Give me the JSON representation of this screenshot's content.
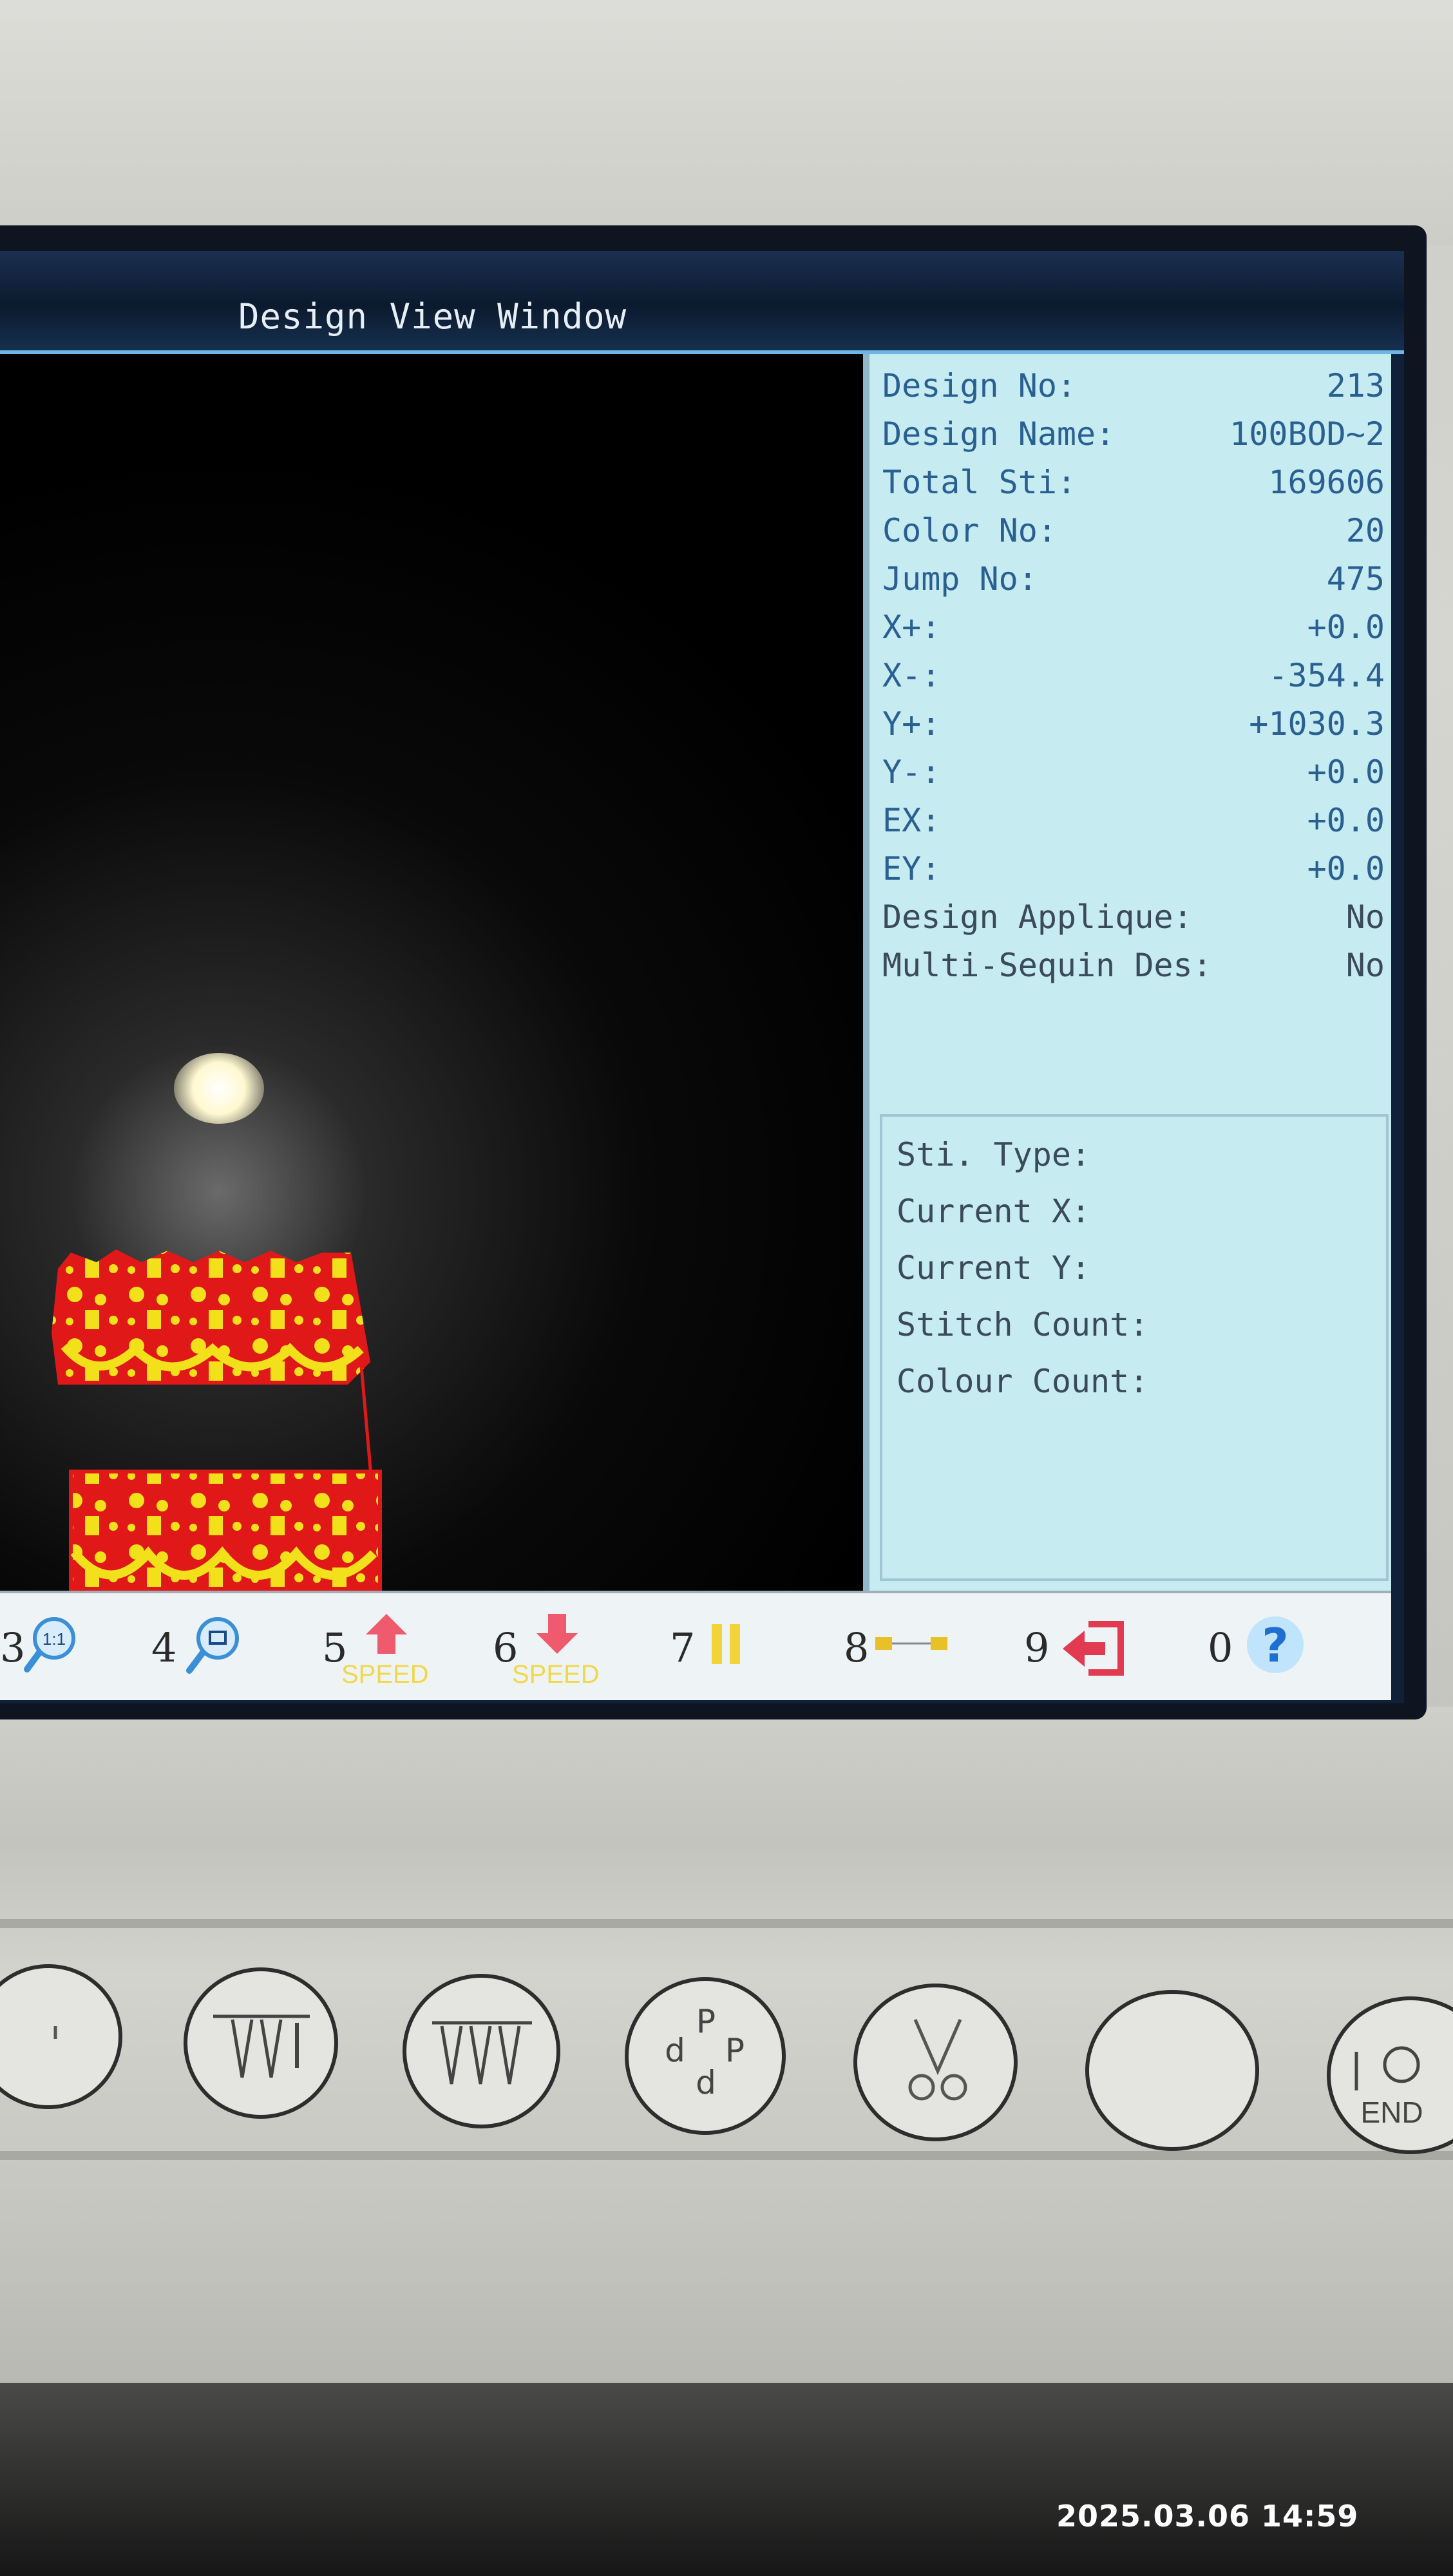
{
  "window": {
    "title": "Design View Window"
  },
  "info": {
    "rows": [
      {
        "label": "Design No:",
        "value": "213"
      },
      {
        "label": "Design Name:",
        "value": "100BOD~2"
      },
      {
        "label": "Total Sti:",
        "value": "169606"
      },
      {
        "label": "Color No:",
        "value": "20"
      },
      {
        "label": "Jump No:",
        "value": "475"
      },
      {
        "label": "X+:",
        "value": "+0.0"
      },
      {
        "label": "X-:",
        "value": "-354.4"
      },
      {
        "label": "Y+:",
        "value": "+1030.3"
      },
      {
        "label": "Y-:",
        "value": "+0.0"
      },
      {
        "label": "EX:",
        "value": "+0.0"
      },
      {
        "label": "EY:",
        "value": "+0.0"
      },
      {
        "label": "Design Applique:",
        "value": "No"
      },
      {
        "label": "Multi-Sequin Des:",
        "value": "No"
      }
    ],
    "status": {
      "sti_type": "Sti. Type:",
      "current_x": "Current X:",
      "current_y": "Current Y:",
      "stitch_count": "Stitch Count:",
      "colour_count": "Colour Count:"
    }
  },
  "toolbar": {
    "items": [
      {
        "num": "3",
        "icon": "zoom-1to1-icon",
        "label": "1:1"
      },
      {
        "num": "4",
        "icon": "zoom-fit-icon"
      },
      {
        "num": "5",
        "icon": "speed-up-icon",
        "label": "SPEED"
      },
      {
        "num": "6",
        "icon": "speed-down-icon",
        "label": "SPEED"
      },
      {
        "num": "7",
        "icon": "pause-icon"
      },
      {
        "num": "8",
        "icon": "stitch-step-icon"
      },
      {
        "num": "9",
        "icon": "return-icon"
      },
      {
        "num": "0",
        "icon": "help-icon"
      }
    ]
  },
  "panel_buttons": [
    {
      "icon": "blank-icon"
    },
    {
      "icon": "needle-single-icon"
    },
    {
      "icon": "needles-multi-icon"
    },
    {
      "icon": "rotate-p-icon"
    },
    {
      "icon": "trim-scissors-icon"
    },
    {
      "icon": "blank-icon"
    },
    {
      "icon": "end-flower-icon",
      "label": "END"
    }
  ],
  "timestamp": "2025.03.06 14:59",
  "colors": {
    "accent": "#2a5f92",
    "panel_bg": "#c6ebf0",
    "design_red": "#e01818",
    "design_yellow": "#f2e01a"
  }
}
